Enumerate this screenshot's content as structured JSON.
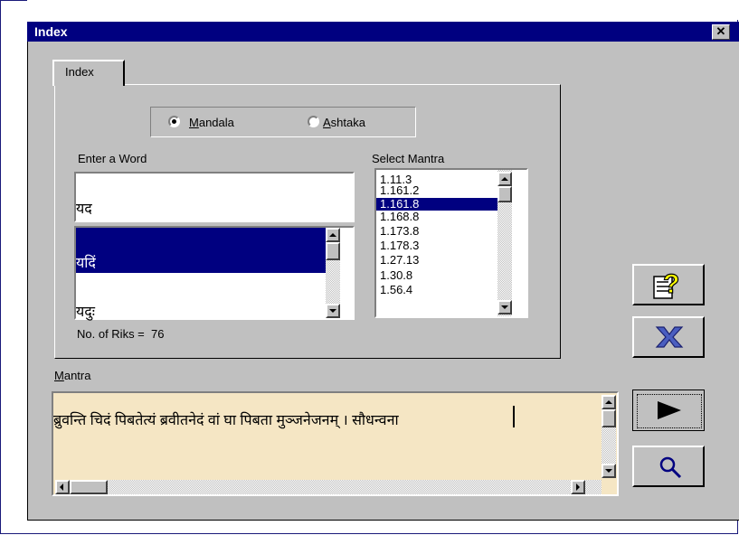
{
  "window": {
    "title": "Index",
    "close_label": "✕"
  },
  "tab": {
    "label": "Index"
  },
  "radios": [
    {
      "label": "Mandala",
      "underline": "M",
      "rest": "andala",
      "selected": true
    },
    {
      "label": "Ashtaka",
      "underline": "A",
      "rest": "shtaka",
      "selected": false
    }
  ],
  "word": {
    "label": "Enter a Word",
    "input_value": "यद",
    "list": [
      "यदिं",
      "यदुः"
    ],
    "selected_index": 0
  },
  "select_mantra": {
    "label": "Select Mantra",
    "items": [
      "1.11.3",
      "1.161.2",
      "1.161.8",
      "1.168.8",
      "1.173.8",
      "1.178.3",
      "1.27.13",
      "1.30.8",
      "1.56.4"
    ],
    "selected_index": 2
  },
  "riks": {
    "label": "No. of Riks =",
    "count": "76"
  },
  "mantra": {
    "label_underline": "M",
    "label_rest": "antra",
    "text": "ब्रुवन्ति चिदं पिबतेत्यं ब्रवीतनेदं वां घा पिबता मुञ्जनेजनम् । सौधन्वना"
  },
  "buttons": {
    "help_icon": "help-icon",
    "close_icon": "x-icon",
    "play_icon": "play-icon",
    "search_icon": "magnifier-icon"
  },
  "colors": {
    "titlebar": "#000080",
    "face": "#c0c0c0",
    "selection": "#000080",
    "mantra_bg": "#f5e6c4",
    "help_yellow": "#ffff00",
    "x_blue": "#4a5ec0"
  }
}
